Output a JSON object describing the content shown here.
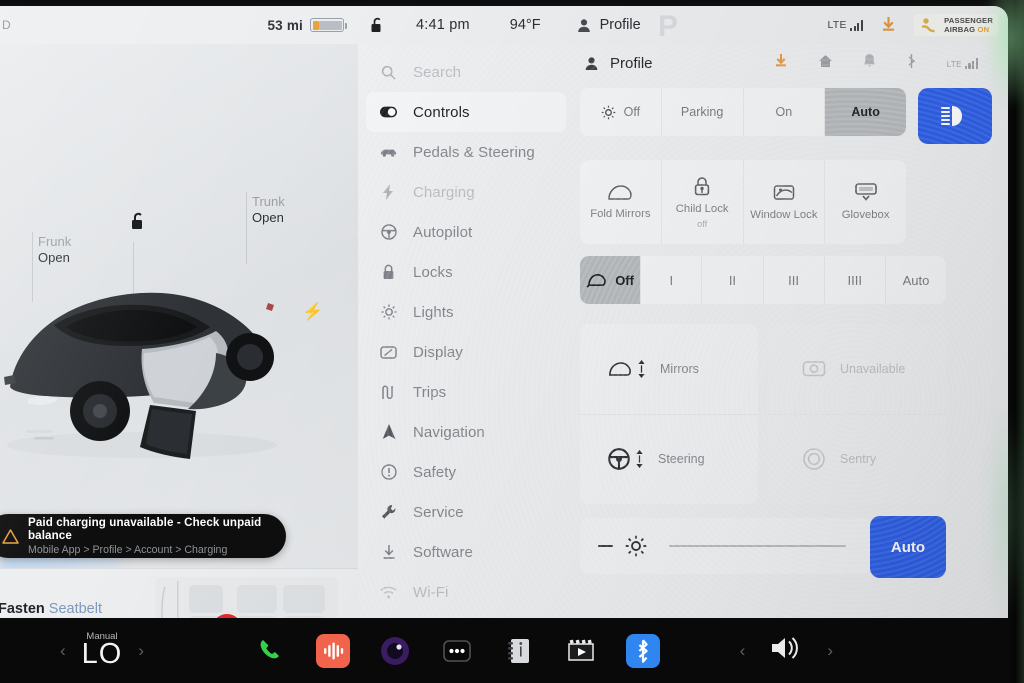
{
  "status_bar": {
    "gear_left": "D",
    "range": "53 mi",
    "lock_icon": "unlocked-padlock-icon",
    "time": "4:41 pm",
    "temperature": "94°F",
    "profile": "Profile",
    "gear": "P",
    "network": "LTE",
    "download_icon": "download-icon",
    "airbag_line1": "PASSENGER",
    "airbag_line2": "AIRBAG",
    "airbag_state": "ON",
    "battery_color": "#e8a33d"
  },
  "car_panel": {
    "frunk_label": "Frunk",
    "frunk_state": "Open",
    "trunk_label": "Trunk",
    "trunk_state": "Open",
    "charge_port_icon": "lightning-bolt-icon",
    "lock_icon": "unlocked-padlock-icon",
    "alert": {
      "title": "Paid charging unavailable - Check unpaid balance",
      "path": "Mobile App > Profile > Account > Charging",
      "icon": "warning-triangle-icon"
    },
    "seatbelt": {
      "word_bold": "Fasten",
      "word_light": "Seatbelt",
      "badge_icon": "seatbelt-warning-icon",
      "badge_color": "#e8282d"
    }
  },
  "sidebar": {
    "items": [
      {
        "label": "Search",
        "icon": "search-icon",
        "state": "dim"
      },
      {
        "label": "Controls",
        "icon": "toggle-icon",
        "state": "active"
      },
      {
        "label": "Pedals & Steering",
        "icon": "car-icon",
        "state": "mid"
      },
      {
        "label": "Charging",
        "icon": "lightning-bolt-icon",
        "state": "dim"
      },
      {
        "label": "Autopilot",
        "icon": "steering-wheel-icon",
        "state": "mid"
      },
      {
        "label": "Locks",
        "icon": "padlock-icon",
        "state": "mid"
      },
      {
        "label": "Lights",
        "icon": "sun-icon",
        "state": "mid"
      },
      {
        "label": "Display",
        "icon": "display-icon",
        "state": "mid"
      },
      {
        "label": "Trips",
        "icon": "trips-icon",
        "state": "mid"
      },
      {
        "label": "Navigation",
        "icon": "navigation-arrow-icon",
        "state": "mid"
      },
      {
        "label": "Safety",
        "icon": "alert-circle-icon",
        "state": "mid"
      },
      {
        "label": "Service",
        "icon": "wrench-icon",
        "state": "mid"
      },
      {
        "label": "Software",
        "icon": "download-icon",
        "state": "mid"
      },
      {
        "label": "Wi-Fi",
        "icon": "wifi-icon",
        "state": "dim"
      }
    ]
  },
  "panel": {
    "header": {
      "title": "Profile",
      "avatar_icon": "person-icon",
      "icons": [
        "download-icon",
        "home-icon",
        "bell-icon",
        "bluetooth-icon",
        "lte-signal-icon"
      ],
      "download_color": "#e8953a"
    },
    "headlights": {
      "icon": "headlight-sun-icon",
      "options": [
        "Off",
        "Parking",
        "On",
        "Auto"
      ],
      "selected": "Auto",
      "high_beam_icon": "high-beam-icon",
      "high_beam_color": "#2f5fe8"
    },
    "tiles": [
      {
        "label": "Fold Mirrors",
        "sub": "",
        "icon": "mirror-icon"
      },
      {
        "label": "Child Lock",
        "sub": "off",
        "icon": "child-lock-icon"
      },
      {
        "label": "Window Lock",
        "sub": "",
        "icon": "window-lock-icon"
      },
      {
        "label": "Glovebox",
        "sub": "",
        "icon": "glovebox-icon"
      }
    ],
    "wipers": {
      "icon": "wiper-icon",
      "options": [
        "Off",
        "I",
        "II",
        "III",
        "IIII",
        "Auto"
      ],
      "selected": "Off"
    },
    "adjust": {
      "left": [
        {
          "label": "Mirrors",
          "icon": "mirror-updown-icon"
        },
        {
          "label": "Steering",
          "icon": "steering-updown-icon"
        }
      ],
      "right": [
        {
          "label": "Unavailable",
          "icon": "dashcam-icon"
        },
        {
          "label": "Sentry",
          "icon": "sentry-icon"
        }
      ]
    },
    "brightness": {
      "minus_icon": "minus-icon",
      "sun_icon": "brightness-sun-icon",
      "auto_label": "Auto",
      "auto_color": "#2f5fe8"
    }
  },
  "taskbar": {
    "climate": {
      "mode": "Manual",
      "value": "LO",
      "prev_icon": "chevron-left-icon",
      "next_icon": "chevron-right-icon"
    },
    "apps": [
      {
        "name": "phone-icon",
        "color": "#35d04a"
      },
      {
        "name": "audio-app-icon",
        "color": "#f2634b"
      },
      {
        "name": "camera-app-icon",
        "color": "#5b2d8e"
      },
      {
        "name": "more-dots-icon",
        "color": "#1d1d1f"
      },
      {
        "name": "notes-app-icon",
        "color": "#d8dadd"
      },
      {
        "name": "video-app-icon",
        "color": "#1d1d1f"
      },
      {
        "name": "bluetooth-app-icon",
        "color": "#2f86f0"
      }
    ],
    "volume": {
      "icon": "speaker-icon",
      "prev_icon": "chevron-left-icon",
      "next_icon": "chevron-right-icon"
    }
  }
}
